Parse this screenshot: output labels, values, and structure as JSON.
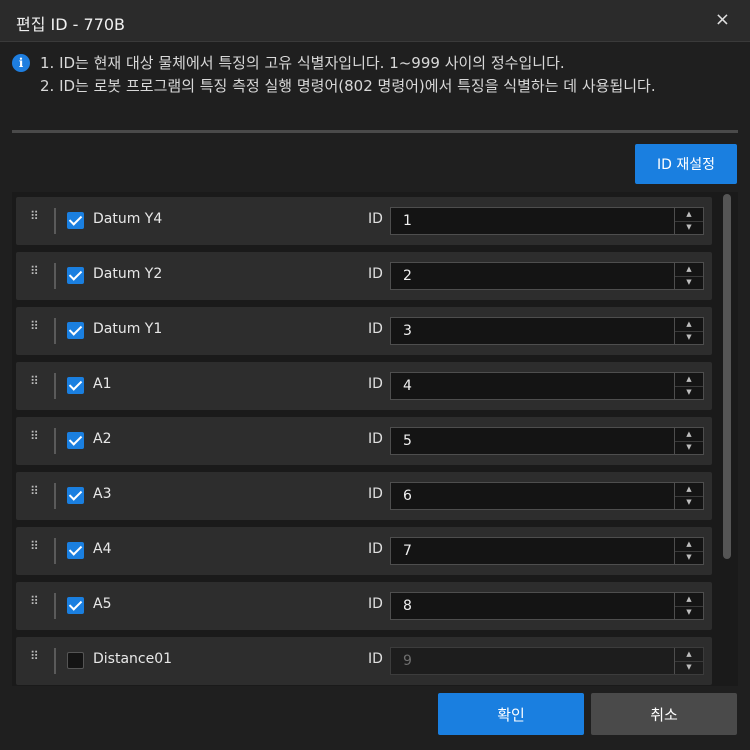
{
  "dialog": {
    "title": "편집 ID - 770B",
    "close_glyph": "×"
  },
  "info": {
    "icon_glyph": "i",
    "lines": [
      "1. ID는 현재 대상 물체에서 특징의 고유 식별자입니다. 1~999 사이의 정수입니다.",
      "2. ID는 로봇 프로그램의 특징 측정 실행 명령어(802 명령어)에서 특징을 식별하는 데 사용됩니다."
    ]
  },
  "reset_button": "ID 재설정",
  "id_label": "ID",
  "rows": [
    {
      "name": "Datum Y4",
      "checked": true,
      "id": "1"
    },
    {
      "name": "Datum Y2",
      "checked": true,
      "id": "2"
    },
    {
      "name": "Datum Y1",
      "checked": true,
      "id": "3"
    },
    {
      "name": "A1",
      "checked": true,
      "id": "4"
    },
    {
      "name": "A2",
      "checked": true,
      "id": "5"
    },
    {
      "name": "A3",
      "checked": true,
      "id": "6"
    },
    {
      "name": "A4",
      "checked": true,
      "id": "7"
    },
    {
      "name": "A5",
      "checked": true,
      "id": "8"
    },
    {
      "name": "Distance01",
      "checked": false,
      "id": "9"
    }
  ],
  "footer": {
    "ok": "확인",
    "cancel": "취소"
  },
  "colors": {
    "accent": "#1a7fe0",
    "row_bg": "#2d2d2d",
    "dialog_bg": "#1f1f1f"
  }
}
